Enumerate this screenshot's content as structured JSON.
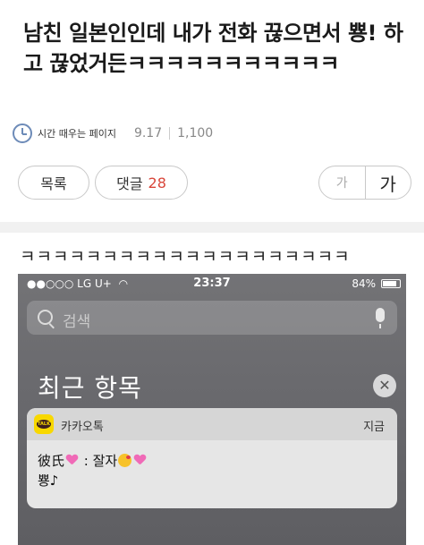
{
  "post": {
    "title": "남친 일본인인데 내가 전화 끊으면서 뿅! 하고 끊었거든ㅋㅋㅋㅋㅋㅋㅋㅋㅋㅋㅋ",
    "author": "시간 때우는 페이지",
    "date": "9.17",
    "views": "1,100",
    "body_text": "ㅋㅋㅋㅋㅋㅋㅋㅋㅋㅋㅋㅋㅋㅋㅋㅋㅋㅋㅋㅋ"
  },
  "buttons": {
    "list_label": "목록",
    "comment_label": "댓글",
    "comment_count": "28",
    "font_small": "가",
    "font_large": "가"
  },
  "phone": {
    "carrier": "●●○○○ LG U+",
    "time": "23:37",
    "battery_text": "84%",
    "battery_level": 0.84,
    "search_placeholder": "검색",
    "recent_title": "최근 항목",
    "clear_icon": "✕",
    "notification": {
      "app_icon_text": "TALK",
      "app_name": "카카오톡",
      "time": "지금",
      "msg_part1": "彼氏",
      "msg_part2": " : 잘자",
      "msg_line2": "뿅♪"
    }
  },
  "icons": [
    "clock-icon",
    "wifi-icon",
    "search-icon",
    "mic-icon",
    "clear-icon",
    "kakaotalk-icon",
    "heart-icon",
    "kiss-icon"
  ]
}
